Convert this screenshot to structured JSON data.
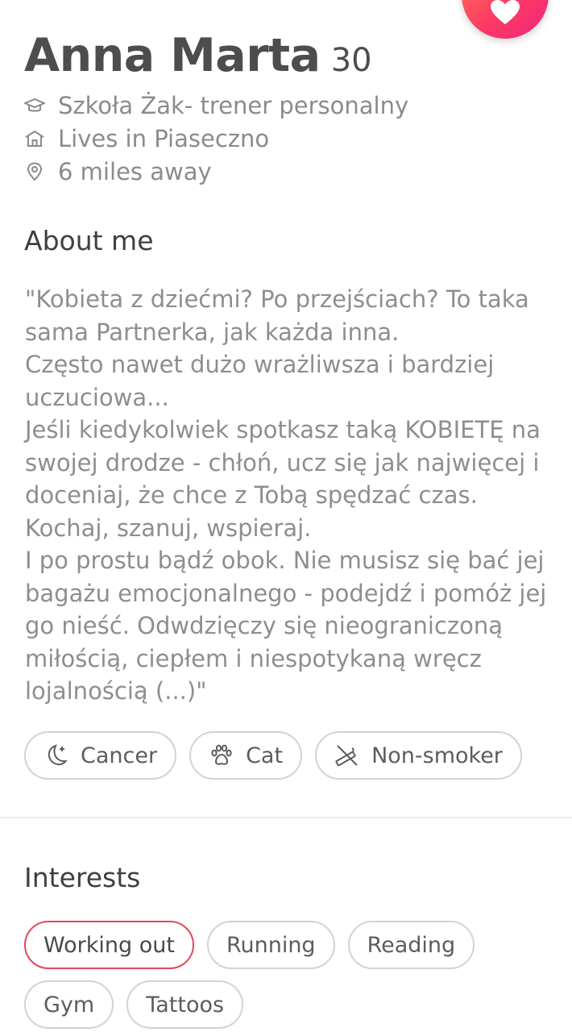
{
  "profile": {
    "name": "Anna Marta",
    "age": "30",
    "job": "Szkoła Żak- trener personalny",
    "lives": "Lives in Piaseczno",
    "distance": "6 miles away"
  },
  "about": {
    "title": "About me",
    "bio": "\"Kobieta z dziećmi? Po przejściach? To taka sama Partnerka, jak każda inna.\nCzęsto nawet dużo wrażliwsza i bardziej uczuciowa...\nJeśli kiedykolwiek spotkasz taką KOBIETĘ na swojej drodze - chłoń, ucz się jak najwięcej i doceniaj, że chce z Tobą spędzać czas. Kochaj, szanuj, wspieraj.\nI po prostu bądź obok. Nie musisz się bać jej bagażu emocjonalnego - podejdź i pomóż jej go nieść. Odwdzięczy się nieograniczoną miłością, ciepłem i niespotykaną wręcz lojalnością (...)\""
  },
  "basics": [
    {
      "label": "Cancer",
      "icon": "moon-star-icon"
    },
    {
      "label": "Cat",
      "icon": "paw-icon"
    },
    {
      "label": "Non-smoker",
      "icon": "no-smoking-icon"
    }
  ],
  "interests": {
    "title": "Interests",
    "items": [
      {
        "label": "Working out",
        "active": true
      },
      {
        "label": "Running",
        "active": false
      },
      {
        "label": "Reading",
        "active": false
      },
      {
        "label": "Gym",
        "active": false
      },
      {
        "label": "Tattoos",
        "active": false
      }
    ]
  },
  "colors": {
    "accent": "#fd3b64",
    "active_border": "#e0485a",
    "muted_text": "#8b8b8b"
  }
}
